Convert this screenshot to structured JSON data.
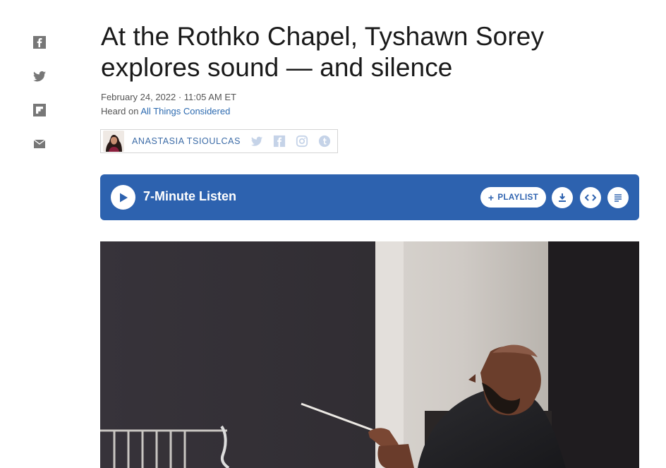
{
  "share": {
    "icons": [
      "facebook-icon",
      "twitter-icon",
      "flipboard-icon",
      "email-icon"
    ],
    "icon_color": "#777777"
  },
  "article": {
    "headline": "At the Rothko Chapel, Tyshawn Sorey explores sound — and silence",
    "dateline": "February 24, 2022 · 11:05 AM ET",
    "heard_on_prefix": "Heard on ",
    "program": "All Things Considered"
  },
  "byline": {
    "author": "ANASTASIA TSIOULCAS",
    "social_icons": [
      "twitter-icon",
      "facebook-icon",
      "instagram-icon",
      "tumblr-icon"
    ],
    "social_color": "#c5d3e8"
  },
  "player": {
    "label": "7-Minute Listen",
    "playlist_label": "PLAYLIST",
    "playlist_prefix": "+",
    "buttons": [
      "download-icon",
      "embed-icon",
      "transcript-icon"
    ],
    "background": "#2d62af"
  },
  "photo": {
    "subject": "conductor-with-baton"
  }
}
